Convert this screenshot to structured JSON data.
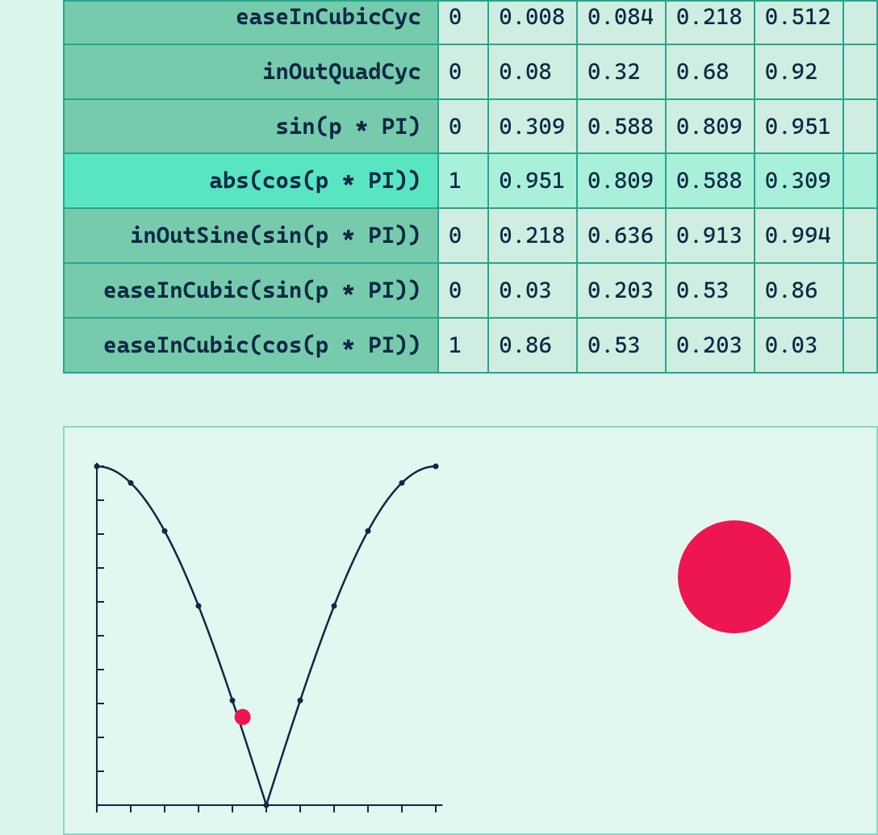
{
  "table": {
    "highlight_row_index": 3,
    "rows": [
      {
        "fn": "easeInCubicCyc",
        "vals": [
          "0",
          "0.008",
          "0.084",
          "0.218",
          "0.512"
        ]
      },
      {
        "fn": "inOutQuadCyc",
        "vals": [
          "0",
          "0.08",
          "0.32",
          "0.68",
          "0.92"
        ]
      },
      {
        "fn": "sin(p * PI)",
        "vals": [
          "0",
          "0.309",
          "0.588",
          "0.809",
          "0.951"
        ]
      },
      {
        "fn": "abs(cos(p * PI))",
        "vals": [
          "1",
          "0.951",
          "0.809",
          "0.588",
          "0.309"
        ]
      },
      {
        "fn": "inOutSine(sin(p * PI))",
        "vals": [
          "0",
          "0.218",
          "0.636",
          "0.913",
          "0.994"
        ]
      },
      {
        "fn": "easeInCubic(sin(p * PI))",
        "vals": [
          "0",
          "0.03",
          "0.203",
          "0.53",
          "0.86"
        ]
      },
      {
        "fn": "easeInCubic(cos(p * PI))",
        "vals": [
          "1",
          "0.86",
          "0.53",
          "0.203",
          "0.03"
        ]
      }
    ]
  },
  "chart_data": {
    "type": "line",
    "title": "",
    "xlabel": "",
    "ylabel": "",
    "xlim": [
      0,
      1
    ],
    "ylim": [
      0,
      1
    ],
    "x_ticks": [
      0,
      0.1,
      0.2,
      0.3,
      0.4,
      0.5,
      0.6,
      0.7,
      0.8,
      0.9,
      1.0
    ],
    "y_ticks": [
      0,
      0.1,
      0.2,
      0.3,
      0.4,
      0.5,
      0.6,
      0.7,
      0.8,
      0.9,
      1.0
    ],
    "series": [
      {
        "name": "abs(cos(p * PI))",
        "x": [
          0,
          0.1,
          0.2,
          0.3,
          0.4,
          0.5,
          0.6,
          0.7,
          0.8,
          0.9,
          1.0
        ],
        "values": [
          1,
          0.951,
          0.809,
          0.588,
          0.309,
          0,
          0.309,
          0.588,
          0.809,
          0.951,
          1
        ]
      }
    ],
    "marker": {
      "x": 0.43,
      "y": 0.26,
      "color": "#ed1651"
    },
    "indicator_ball": {
      "color": "#ed1651"
    }
  }
}
